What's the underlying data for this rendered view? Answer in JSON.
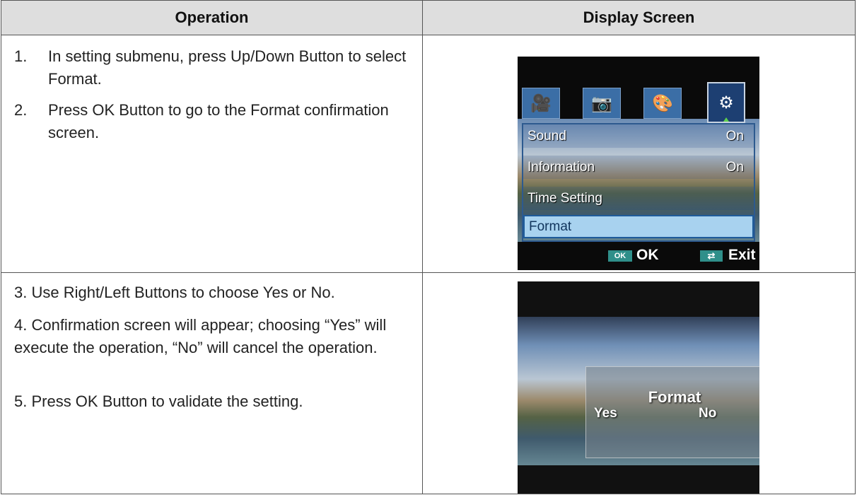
{
  "table": {
    "headers": [
      "Operation",
      "Display Screen"
    ],
    "row1": {
      "steps": [
        {
          "num": "1.",
          "text": "In setting submenu, press Up/Down Button to select Format."
        },
        {
          "num": "2.",
          "text": "Press OK Button to go to the Format confirmation screen."
        }
      ]
    },
    "row2": {
      "paragraphs": [
        "3. Use Right/Left Buttons to choose Yes or No.",
        "4. Confirmation screen will appear; choosing “Yes” will execute the operation, “No” will cancel the operation.",
        "5. Press OK Button to validate the setting."
      ]
    }
  },
  "screen1": {
    "tab_icons": [
      "movie-camera-icon",
      "camera-icon",
      "palette-icon",
      "gear-icon"
    ],
    "menu_items": [
      {
        "label": "Sound",
        "value": "On"
      },
      {
        "label": "Information",
        "value": "On"
      },
      {
        "label": "Time Setting",
        "value": ""
      },
      {
        "label": "Format",
        "value": ""
      }
    ],
    "selected": "Format",
    "footer": {
      "ok_badge": "OK",
      "ok_label": "OK",
      "exit_label": "Exit"
    }
  },
  "screen2": {
    "title": "Format",
    "options": [
      "Yes",
      "No"
    ]
  }
}
